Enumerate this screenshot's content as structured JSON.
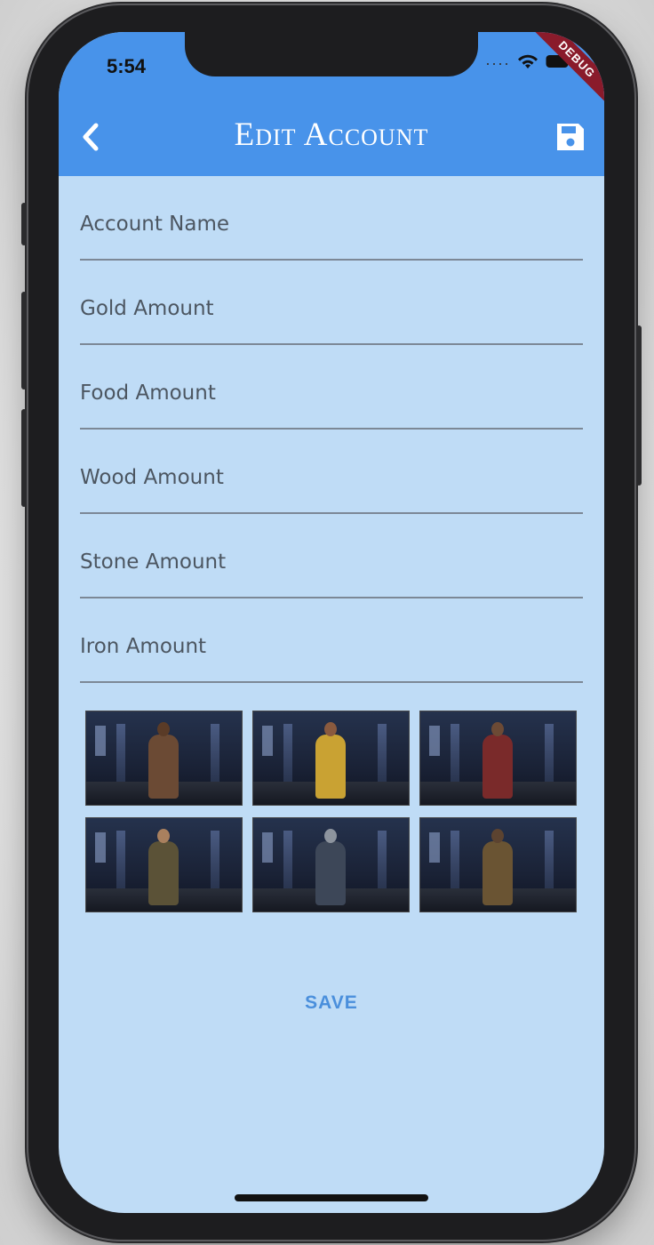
{
  "status_bar": {
    "time": "5:54"
  },
  "debug_banner": "DEBUG",
  "app_bar": {
    "title": "Edit Account"
  },
  "form": {
    "fields": [
      {
        "placeholder": "Account Name"
      },
      {
        "placeholder": "Gold Amount"
      },
      {
        "placeholder": "Food Amount"
      },
      {
        "placeholder": "Wood Amount"
      },
      {
        "placeholder": "Stone Amount"
      },
      {
        "placeholder": "Iron Amount"
      }
    ]
  },
  "portraits": [
    {
      "name": "portrait-1",
      "body_color": "#6b4a34",
      "head_color": "#5a3b27"
    },
    {
      "name": "portrait-2",
      "body_color": "#c9a233",
      "head_color": "#8a5a3e"
    },
    {
      "name": "portrait-3",
      "body_color": "#7a2a2a",
      "head_color": "#6c4a35"
    },
    {
      "name": "portrait-4",
      "body_color": "#5b5237",
      "head_color": "#a9805e"
    },
    {
      "name": "portrait-5",
      "body_color": "#3d4758",
      "head_color": "#8d949e"
    },
    {
      "name": "portrait-6",
      "body_color": "#6a5433",
      "head_color": "#5c4330"
    }
  ],
  "save_label": "SAVE",
  "colors": {
    "app_bar": "#4893ea",
    "background": "#bfdcf6",
    "save_text": "#4a8fdc",
    "debug": "#8a1b2b"
  }
}
